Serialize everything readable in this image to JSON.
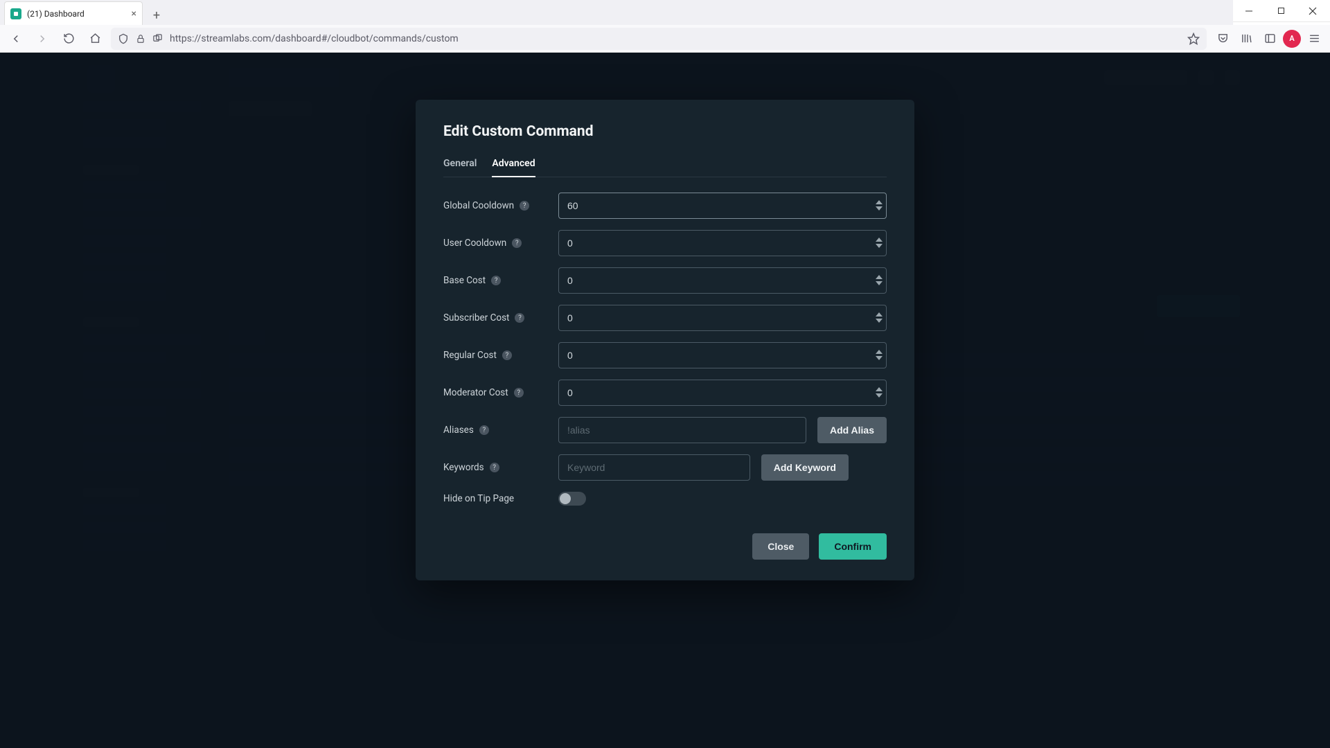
{
  "browser": {
    "tab_title": "(21) Dashboard",
    "url": "https://streamlabs.com/dashboard#/cloudbot/commands/custom"
  },
  "modal": {
    "title": "Edit Custom Command",
    "tabs": {
      "general": "General",
      "advanced": "Advanced",
      "active": "advanced"
    },
    "fields": {
      "global_cooldown": {
        "label": "Global Cooldown",
        "value": "60"
      },
      "user_cooldown": {
        "label": "User Cooldown",
        "value": "0"
      },
      "base_cost": {
        "label": "Base Cost",
        "value": "0"
      },
      "subscriber_cost": {
        "label": "Subscriber Cost",
        "value": "0"
      },
      "regular_cost": {
        "label": "Regular Cost",
        "value": "0"
      },
      "moderator_cost": {
        "label": "Moderator Cost",
        "value": "0"
      },
      "aliases": {
        "label": "Aliases",
        "placeholder": "!alias",
        "button": "Add Alias"
      },
      "keywords": {
        "label": "Keywords",
        "placeholder": "Keyword",
        "button": "Add Keyword"
      },
      "hide_tip": {
        "label": "Hide on Tip Page",
        "value": false
      }
    },
    "buttons": {
      "close": "Close",
      "confirm": "Confirm"
    }
  },
  "colors": {
    "accent": "#31bc9f",
    "panel": "#17242d",
    "page_bg": "#0f1923"
  }
}
